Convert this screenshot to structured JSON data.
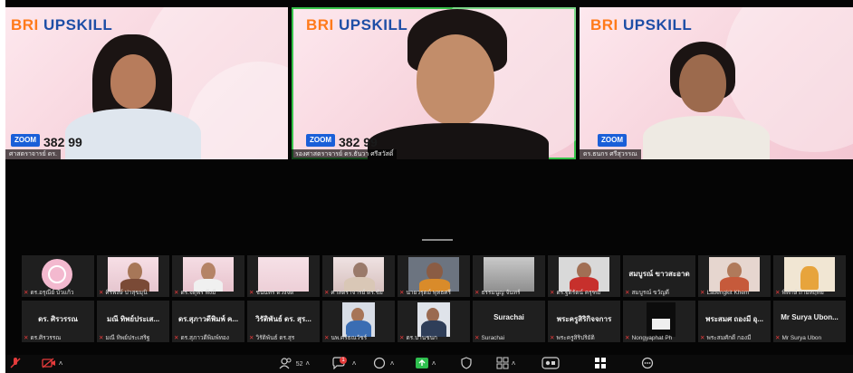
{
  "speakers": [
    {
      "brand_a": "BRI",
      "brand_b": "UPSKILL",
      "zoom_tag": "ZOOM",
      "zoom_id": "382 99",
      "name": "ศาสตราจารย์ ดร."
    },
    {
      "brand_a": "BRI",
      "brand_b": "UPSKILL",
      "zoom_tag": "ZOOM",
      "zoom_id": "382 99",
      "name": "รองศาสตราจารย์ ดร.ธันวา ศรีสวัสดิ์"
    },
    {
      "brand_a": "BRI",
      "brand_b": "UPSKILL",
      "zoom_tag": "ZOOM",
      "zoom_id": "",
      "name": "ดร.ธนกร ศรีสุวรรณ"
    }
  ],
  "gallery_row1": [
    {
      "label": "ดร.อรุณีย์ บัวแก้ว",
      "type": "avatar"
    },
    {
      "label": "ศิริพงษ์ ปาสุขมุนิ",
      "type": "video"
    },
    {
      "label": "ดร.จตุพร พึงมี",
      "type": "video"
    },
    {
      "label": "ชนินทร์ ดวงจิต",
      "type": "video"
    },
    {
      "label": "ศาสตราจารย์ ดร.ชัย",
      "type": "video"
    },
    {
      "label": "นายวรุตม์ พุทธศรี",
      "type": "video"
    },
    {
      "label": "ธรรมนูญ จันทร์",
      "type": "video"
    },
    {
      "label": "ดร.ฐิติรัตน์ ครุฑมี",
      "type": "video"
    },
    {
      "label": "สมบูรณ์ ขวัญดี",
      "type": "name",
      "big": "สมบูรณ์ ขาวสะอาด"
    },
    {
      "label": "Laoengkit Khem",
      "type": "video"
    },
    {
      "label": "พิทักษ์ ถ่ายหฤทัย",
      "type": "video"
    }
  ],
  "gallery_row2": [
    {
      "label": "ดร.ศิรวรรณ",
      "type": "name",
      "big": "ดร. ศิรวรรณ"
    },
    {
      "label": "มณี ทิพย์ประเสริฐ",
      "type": "name",
      "big": "มณี ทิพย์ประเส..."
    },
    {
      "label": "ดร.สุภาวดีพิมพ์ทอง",
      "type": "name",
      "big": "ดร.สุภาวดีพิมพ์ ค..."
    },
    {
      "label": "วิรัติพันธ์ ดร.สุร",
      "type": "name",
      "big": "วิรัติพันธ์ ดร. สุร..."
    },
    {
      "label": "นพ.ศรีธณวัชร์",
      "type": "video"
    },
    {
      "label": "ดร.ปานชนก",
      "type": "video"
    },
    {
      "label": "Surachai",
      "type": "name",
      "big": "Surachai"
    },
    {
      "label": "พระครูสิริปริยัติ",
      "type": "name",
      "big": "พระครูสิริกิจจการ"
    },
    {
      "label": "Nongyaphat Ph",
      "type": "video"
    },
    {
      "label": "พระสมศักดิ์ กองมี",
      "type": "name",
      "big": "พระสมศ ถองมี อุ..."
    },
    {
      "label": "Mr Surya Ubon",
      "type": "name",
      "big": "Mr Surya Ubon..."
    }
  ],
  "toolbar": {
    "participants_count": "52",
    "chat_badge": "1",
    "items": [
      "audio",
      "video",
      "participants",
      "chat",
      "reactions",
      "share",
      "security",
      "record",
      "apps",
      "view",
      "more"
    ]
  },
  "colors": {
    "active_speaker": "#37c34a",
    "mute_red": "#e53b3b",
    "zoom_blue": "#1a5fd8",
    "brand_orange": "#ff7a1a",
    "brand_blue": "#1e4ea6"
  }
}
